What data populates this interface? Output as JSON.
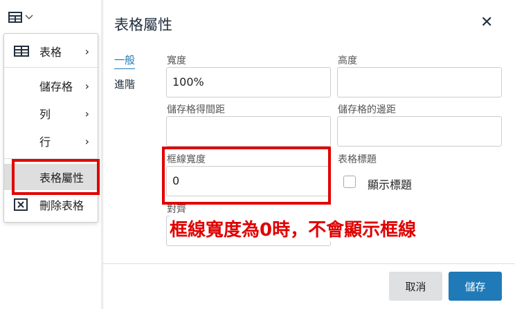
{
  "toolbar": {
    "table_icon": "table-grid-icon",
    "chevron": "⌄"
  },
  "menu": {
    "items": [
      {
        "label": "表格",
        "has_submenu": true
      },
      {
        "label": "儲存格",
        "has_submenu": true
      },
      {
        "label": "列",
        "has_submenu": true
      },
      {
        "label": "行",
        "has_submenu": true
      },
      {
        "label": "表格屬性",
        "has_submenu": false
      },
      {
        "label": "刪除表格",
        "has_submenu": false
      }
    ],
    "arrow": "›"
  },
  "dialog": {
    "title": "表格屬性",
    "close": "✕",
    "tabs": [
      {
        "label": "一般"
      },
      {
        "label": "進階"
      }
    ],
    "fields": {
      "width_label": "寬度",
      "width_value": "100%",
      "height_label": "高度",
      "height_value": "",
      "cellspacing_label": "儲存格得間距",
      "cellspacing_value": "",
      "cellpadding_label": "儲存格的邊距",
      "cellpadding_value": "",
      "border_label": "框線寬度",
      "border_value": "0",
      "caption_label": "表格標題",
      "caption_checkbox_label": "顯示標題",
      "align_label": "對齊"
    },
    "buttons": {
      "cancel": "取消",
      "save": "儲存"
    }
  },
  "annotation": {
    "text": "框線寬度為0時，不會顯示框線",
    "color": "#e00000"
  },
  "colors": {
    "accent": "#207ab7",
    "annotation": "#e00000"
  }
}
